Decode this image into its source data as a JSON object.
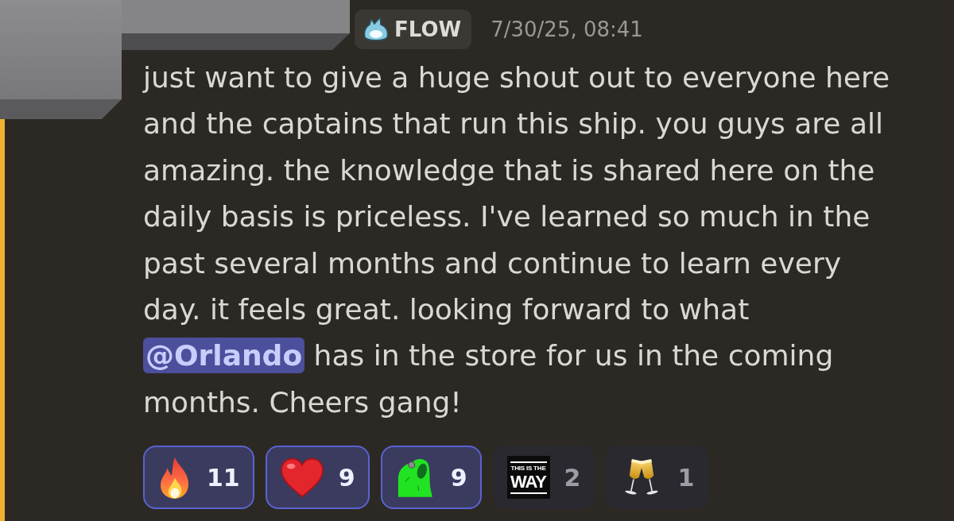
{
  "message": {
    "mentions_you": true,
    "guild_tag": {
      "label": "FLOW"
    },
    "timestamp": "7/30/25, 08:41",
    "body": [
      {
        "kind": "text",
        "text": "just want to give a huge shout out to everyone here and the captains that run this ship. you guys are all amazing. the knowledge that is shared here on the daily basis is priceless. I've learned so much in the past several months and continue to learn every day. it feels great. looking forward to what "
      },
      {
        "kind": "mention",
        "text": "@Orlando"
      },
      {
        "kind": "text",
        "text": " has in the store for us in the coming months. Cheers gang!"
      }
    ],
    "reactions": [
      {
        "kind": "fire",
        "count": "11",
        "selected": true
      },
      {
        "kind": "heart",
        "count": "9",
        "selected": true
      },
      {
        "kind": "blob",
        "count": "9",
        "selected": true
      },
      {
        "kind": "poster",
        "poster_lines": [
          "THIS IS THE",
          "WAY"
        ],
        "count": "2",
        "selected": false
      },
      {
        "kind": "champagne",
        "count": "1",
        "selected": false
      }
    ]
  }
}
